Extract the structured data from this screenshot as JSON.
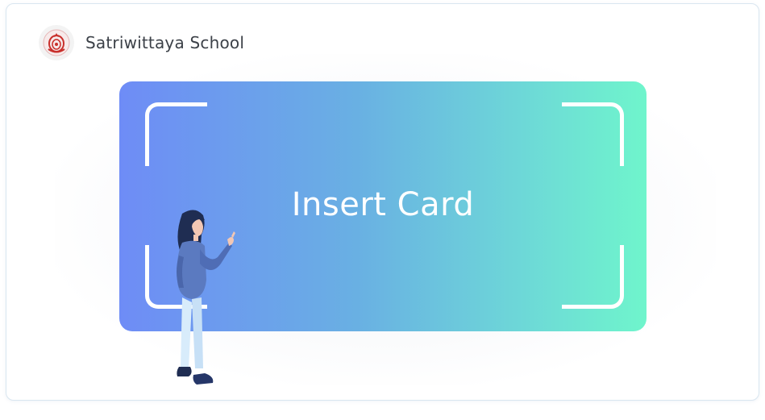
{
  "header": {
    "school_name": "Satriwittaya School",
    "logo_icon": "school-crest-icon"
  },
  "card": {
    "label": "Insert Card",
    "gradient_start": "#6e8cf6",
    "gradient_end": "#6ff5cc"
  },
  "illustration": {
    "icon": "woman-pointing-illustration"
  }
}
